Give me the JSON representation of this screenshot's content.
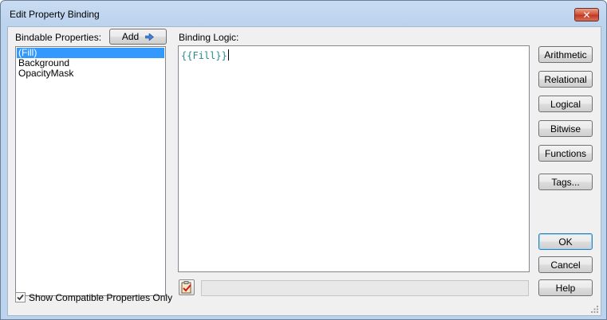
{
  "window": {
    "title": "Edit Property Binding",
    "close_glyph": "✕"
  },
  "left": {
    "label": "Bindable Properties:",
    "add_label": "Add",
    "items": [
      "(Fill)",
      "Background",
      "OpacityMask"
    ],
    "selected_index": 0,
    "show_compatible_label": "Show Compatible Properties Only",
    "show_compatible_checked": true
  },
  "editor": {
    "label": "Binding Logic:",
    "code": "{{Fill}}"
  },
  "side_buttons": [
    "Arithmetic",
    "Relational",
    "Logical",
    "Bitwise",
    "Functions",
    "Tags..."
  ],
  "actions": {
    "ok": "OK",
    "cancel": "Cancel",
    "help": "Help"
  },
  "colors": {
    "selection": "#3399ff",
    "code": "#2e8a8a",
    "title_bar": "#bcd3ee"
  }
}
